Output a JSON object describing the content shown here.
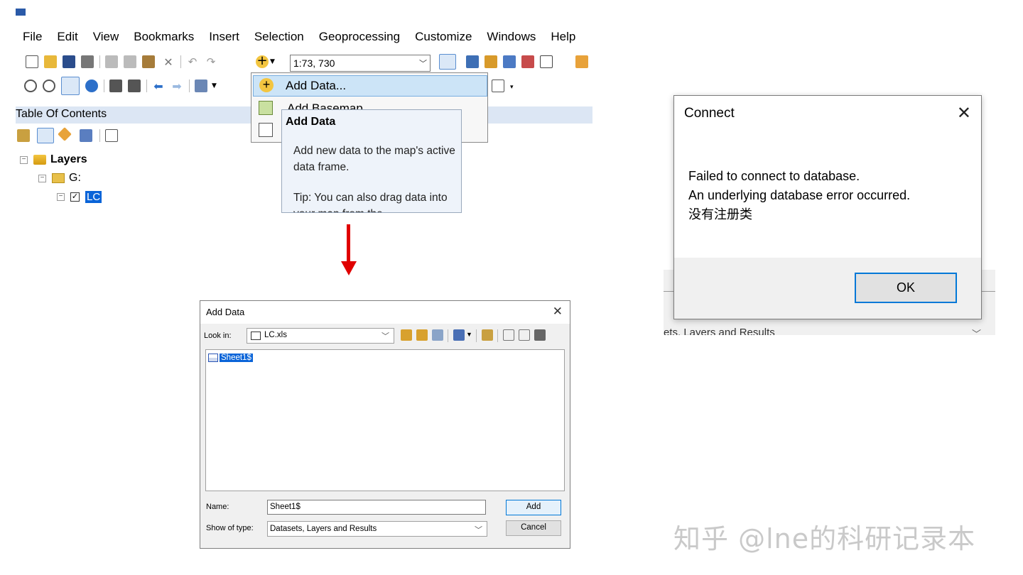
{
  "arcmap": {
    "menu": [
      "File",
      "Edit",
      "View",
      "Bookmarks",
      "Insert",
      "Selection",
      "Geoprocessing",
      "Customize",
      "Windows",
      "Help"
    ],
    "scale_value": "1:73, 730",
    "toc_title": "Table Of Contents",
    "tree": {
      "layers": "Layers",
      "folder": "G:",
      "layer": "LC"
    },
    "dropdown": {
      "item1": "Add Data...",
      "item2": "Add Basemap..."
    },
    "tooltip": {
      "title": "Add Data",
      "body": "Add new data to the map's active data frame.",
      "tip": "Tip: You can also drag data into your map from the"
    }
  },
  "add_data_dialog": {
    "title": "Add Data",
    "close": "✕",
    "look_in_label": "Look in:",
    "look_in_value": "LC.xls",
    "files": [
      "Sheet1$"
    ],
    "name_label": "Name:",
    "name_value": "Sheet1$",
    "type_label": "Show of type:",
    "type_value": "Datasets, Layers and Results",
    "add_label": "Add",
    "cancel_label": "Cancel"
  },
  "connect_dialog": {
    "title": "Connect",
    "close": "✕",
    "line1": "Failed to connect to database.",
    "line2": "An underlying database error occurred.",
    "line3": "没有注册类",
    "ok_label": "OK",
    "behind_text": "ets, Layers and Results"
  },
  "watermark": "知乎 @lne的科研记录本",
  "colors": {
    "accent": "#0078d7",
    "selection": "#0a64d8",
    "arrow": "#e00000",
    "hover": "#cce4f7"
  }
}
